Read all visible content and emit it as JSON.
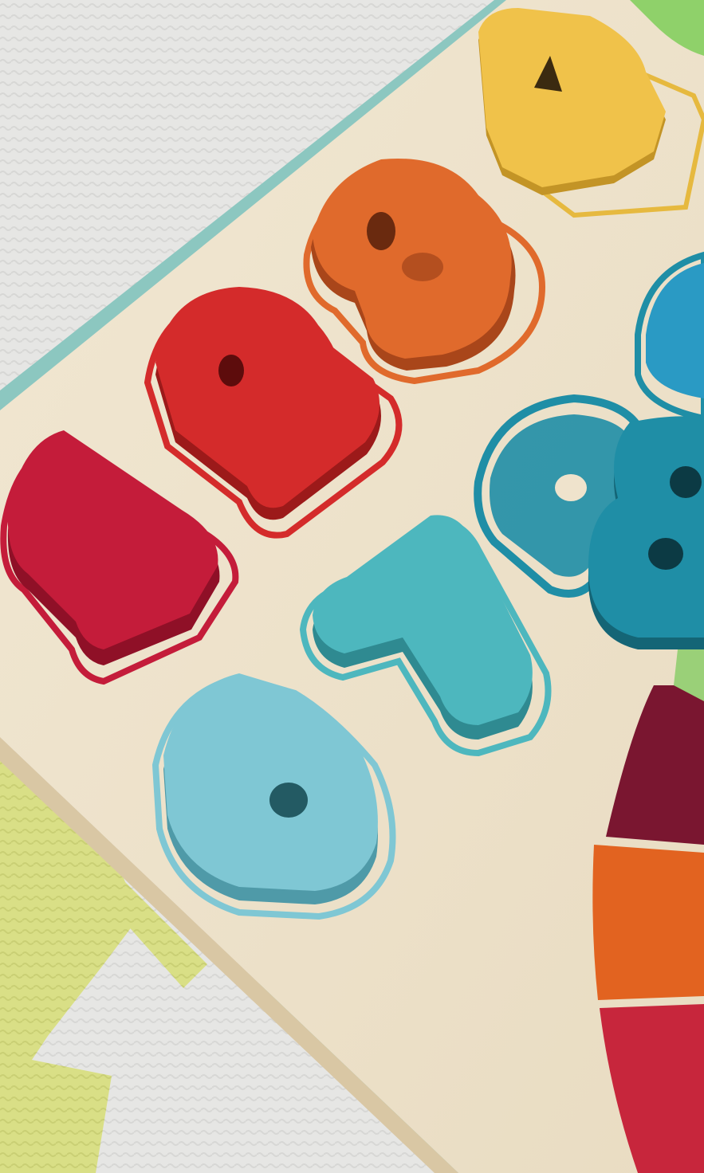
{
  "scene": {
    "description_colors": {
      "mat_white": "#e6e6e4",
      "mat_yellow": "#d9df86",
      "board_wood": "#eee2cc",
      "board_edge": "#8cc7c0"
    },
    "pieces": [
      {
        "digit": "1",
        "color": "#c41c3a",
        "shadow": "#8f1027"
      },
      {
        "digit": "2",
        "color": "#d42b2b",
        "shadow": "#9c1a1a"
      },
      {
        "digit": "3",
        "color": "#e06a2c",
        "shadow": "#a9461a"
      },
      {
        "digit": "4",
        "color": "#f0c24a",
        "shadow": "#c39426"
      },
      {
        "digit": "6",
        "color": "#7fc7d4",
        "shadow": "#4f9aa8"
      },
      {
        "digit": "7",
        "color": "#4db7be",
        "shadow": "#2f8a91"
      },
      {
        "digit": "8",
        "color": "#1f8ea6",
        "shadow": "#146576"
      }
    ],
    "rainbow": [
      "#7a1630",
      "#e26320",
      "#c7263c"
    ]
  }
}
